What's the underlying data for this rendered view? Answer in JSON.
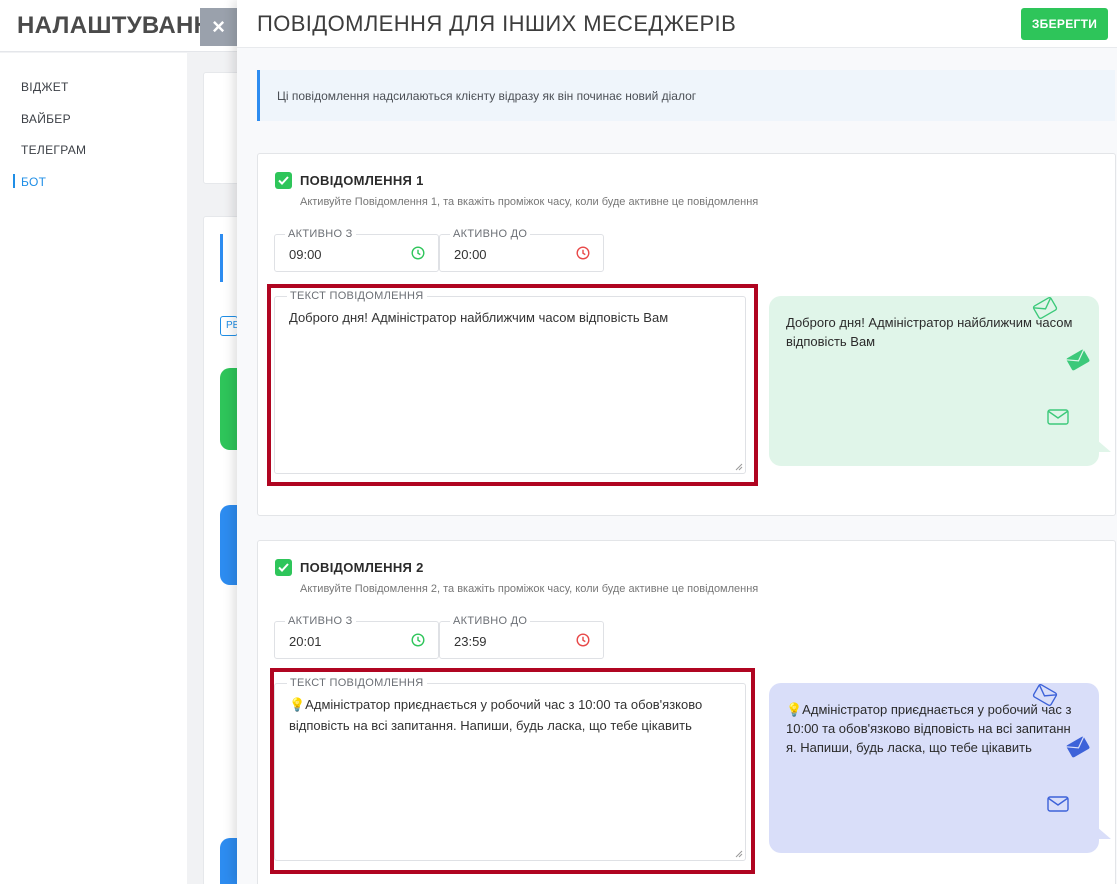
{
  "background": {
    "title": "НАЛАШТУВАННЯ",
    "close_label": "×",
    "nav": [
      "ВІДЖЕТ",
      "ВАЙБЕР",
      "ТЕЛЕГРАМ",
      "БОТ"
    ],
    "active_nav": "БОТ",
    "tag_label": "РЕ"
  },
  "modal": {
    "title": "ПОВІДОМЛЕННЯ ДЛЯ ІНШИХ МЕСЕДЖЕРІВ",
    "save_label": "ЗБЕРЕГТИ",
    "info_text": "Ці повідомлення надсилаються клієнту відразу як він починає новий діалог"
  },
  "messages": [
    {
      "checked": true,
      "title": "ПОВІДОМЛЕННЯ 1",
      "description": "Активуйте Повідомлення 1, та вкажіть проміжок часу, коли буде активне це повідомлення",
      "from_label": "АКТИВНО З",
      "from_value": "09:00",
      "to_label": "АКТИВНО ДО",
      "to_value": "20:00",
      "text_label": "ТЕКСТ ПОВІДОМЛЕННЯ",
      "text_value": "Доброго дня! Адміністратор найближчим часом відповість Вам",
      "preview_text": "Доброго дня! Адміністратор найближчим часом відповість Вам",
      "preview_color": "#e0f5e9",
      "icon_color": "#3cc97a"
    },
    {
      "checked": true,
      "title": "ПОВІДОМЛЕННЯ 2",
      "description": "Активуйте Повідомлення 2, та вкажіть проміжок часу, коли буде активне це повідомлення",
      "from_label": "АКТИВНО З",
      "from_value": "20:01",
      "to_label": "АКТИВНО ДО",
      "to_value": "23:59",
      "text_label": "ТЕКСТ ПОВІДОМЛЕННЯ",
      "text_value": "💡Адміністратор приєднається у робочий час з 10:00 та обов'язково відповість на всі запитання. Напиши, будь ласка, що тебе цікавить",
      "preview_text": "💡Адміністратор приєднається у робочий час з 10:00 та обов'язково відповість на всі запитання. Напиши, будь ласка, що тебе цікавить",
      "preview_color": "#d9def9",
      "icon_color": "#3d62d9"
    }
  ],
  "colors": {
    "save_button": "#2ec55a",
    "checkbox": "#2ec55a",
    "highlight": "#b00521",
    "clock_from": "#2ec55a",
    "clock_to": "#e84848",
    "accent": "#1f8ee6"
  }
}
